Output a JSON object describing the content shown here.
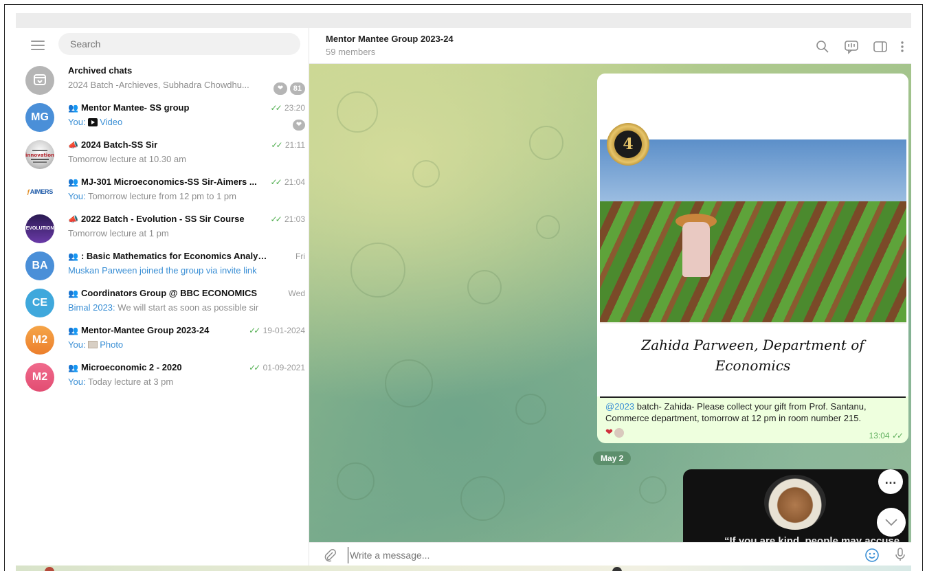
{
  "search": {
    "placeholder": "Search"
  },
  "chats": [
    {
      "avatar": "",
      "title": "Archived chats",
      "sub_prefix": "",
      "sub": "2024 Batch -Archieves, Subhadra Chowdhu...",
      "time": "",
      "badge": "81",
      "color": "#b5b5b5",
      "type": "archive"
    },
    {
      "avatar": "MG",
      "title": "Mentor Mantee- SS group",
      "sub_prefix": "You:",
      "sub": "Video",
      "time": "23:20",
      "badge": "",
      "color": "#4a8fd8",
      "type": "group"
    },
    {
      "avatar": "",
      "title": "2024 Batch-SS Sir",
      "sub_prefix": "",
      "sub": "Tomorrow lecture at 10.30 am",
      "time": "21:11",
      "badge": "",
      "color": "#d7d7d7",
      "type": "channel"
    },
    {
      "avatar": "AIMERS",
      "title": "MJ-301 Microeconomics-SS Sir-Aimers ...",
      "sub_prefix": "You:",
      "sub": "Tomorrow lecture from 12 pm to 1 pm",
      "time": "21:04",
      "badge": "",
      "color": "#ffffff",
      "type": "group"
    },
    {
      "avatar": "EVOLUTION",
      "title": "2022 Batch - Evolution - SS Sir Course",
      "sub_prefix": "",
      "sub": "Tomorrow lecture at 1 pm",
      "time": "21:03",
      "badge": "",
      "color": "#4b2a78",
      "type": "channel"
    },
    {
      "avatar": "BA",
      "title": ": Basic Mathematics for Economics Analysis",
      "sub_prefix": "",
      "sub": "Muskan Parween joined the group via invite link",
      "time": "Fri",
      "badge": "",
      "color": "#4a8fd8",
      "type": "group"
    },
    {
      "avatar": "CE",
      "title": "Coordinators Group @ BBC ECONOMICS",
      "sub_prefix": "Bimal 2023:",
      "sub": "We will start as soon as possible sir",
      "time": "Wed",
      "badge": "",
      "color": "#3fa8dc",
      "type": "group"
    },
    {
      "avatar": "M2",
      "title": "Mentor-Mantee Group 2023-24",
      "sub_prefix": "You:",
      "sub": "Photo",
      "time": "19-01-2024",
      "badge": "",
      "color": "#f0963a",
      "type": "group"
    },
    {
      "avatar": "M2",
      "title": "Microeconomic 2 - 2020",
      "sub_prefix": "You:",
      "sub": "Today lecture at 3 pm",
      "time": "01-09-2021",
      "badge": "",
      "color": "#e65a7c",
      "type": "group"
    }
  ],
  "header": {
    "title": "Mentor Mantee Group 2023-24",
    "members": "59 members"
  },
  "message": {
    "image_caption_line1": "Zahida Parween, Department of",
    "image_caption_line2": "Economics",
    "medal_number": "4",
    "mention": "@2023",
    "text": " batch- Zahida- Please collect your gift from Prof. Santanu, Commerce department, tomorrow at 12 pm in room number 215.",
    "time": "13:04"
  },
  "date_pill": "May 2",
  "message2": {
    "quote": "“If you are kind, people may accuse"
  },
  "composer": {
    "placeholder": "Write a message..."
  },
  "colors": {
    "accent": "#3a8fd5",
    "read_ticks": "#4fae4e",
    "bubble": "#eeffde"
  }
}
